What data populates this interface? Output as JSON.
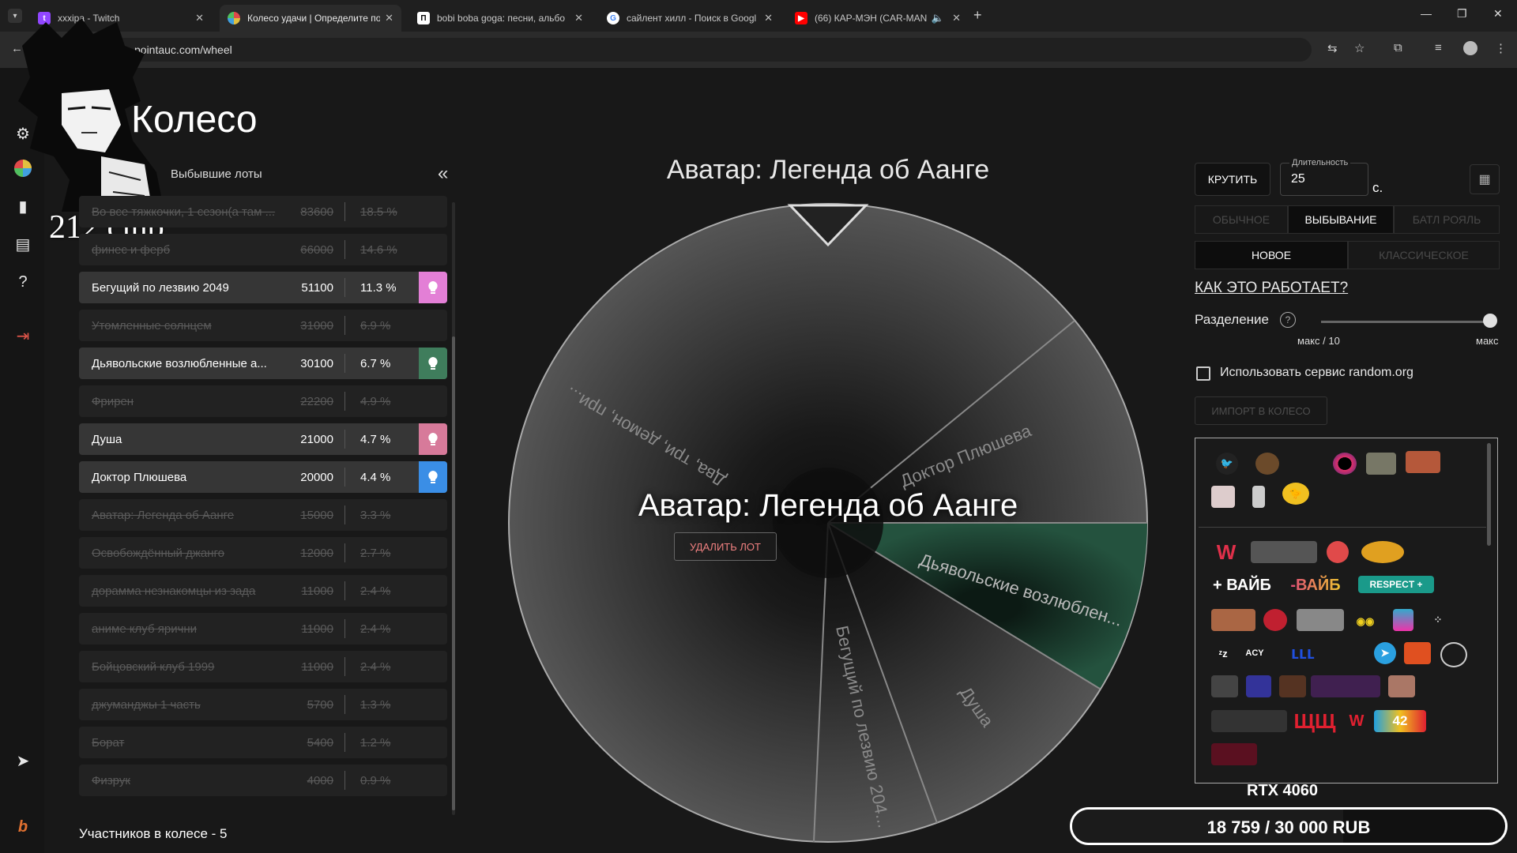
{
  "browser": {
    "tabs": [
      {
        "title": "xxxipa - Twitch",
        "favicon_color": "#9146ff",
        "active": false
      },
      {
        "title": "Колесо удачи | Определите по",
        "favicon_color": "#e0a040",
        "active": true
      },
      {
        "title": "bobi boba goga: песни, альбо",
        "favicon_color": "#444444",
        "active": false
      },
      {
        "title": "сайлент хилл - Поиск в Googl",
        "favicon_color": "#ffffff",
        "active": false
      },
      {
        "title": "(66) КАР-МЭН (CAR-MAN)",
        "favicon_color": "#ff0000",
        "active": false
      }
    ],
    "url": "pointauc.com/wheel"
  },
  "overlay": {
    "club_text": "212 club"
  },
  "page": {
    "title": "Колесо",
    "lots_header": "Выбывшие лоты",
    "participants": "Участников в колесе - 5"
  },
  "lots": [
    {
      "name": "Во все тяжкочки, 1 сезон(а там ...",
      "amount": "83600",
      "percent": "18.5 %",
      "state": "out"
    },
    {
      "name": "финес и ферб",
      "amount": "66000",
      "percent": "14.6 %",
      "state": "out"
    },
    {
      "name": "Бегущий по лезвию 2049",
      "amount": "51100",
      "percent": "11.3 %",
      "state": "alive",
      "color": "#e37fd6"
    },
    {
      "name": "Утомленные солнцем",
      "amount": "31000",
      "percent": "6.9 %",
      "state": "out"
    },
    {
      "name": "Дьявольские возлюбленные а...",
      "amount": "30100",
      "percent": "6.7 %",
      "state": "alive",
      "color": "#3f7d5c"
    },
    {
      "name": "Фрирен",
      "amount": "22200",
      "percent": "4.9 %",
      "state": "out"
    },
    {
      "name": "Душа",
      "amount": "21000",
      "percent": "4.7 %",
      "state": "alive",
      "color": "#d77a9a"
    },
    {
      "name": "Доктор Плюшева",
      "amount": "20000",
      "percent": "4.4 %",
      "state": "alive",
      "color": "#3a8ee6"
    },
    {
      "name": "Аватар: Легенда об Аанге",
      "amount": "15000",
      "percent": "3.3 %",
      "state": "out"
    },
    {
      "name": "Освобождённый джанго",
      "amount": "12000",
      "percent": "2.7 %",
      "state": "out"
    },
    {
      "name": "дорамма незнакомцы из зада",
      "amount": "11000",
      "percent": "2.4 %",
      "state": "out"
    },
    {
      "name": "аниме клуб ярични",
      "amount": "11000",
      "percent": "2.4 %",
      "state": "out"
    },
    {
      "name": "Бойцовский клуб 1999",
      "amount": "11000",
      "percent": "2.4 %",
      "state": "out"
    },
    {
      "name": "джуманджы 1 часть",
      "amount": "5700",
      "percent": "1.3 %",
      "state": "out"
    },
    {
      "name": "Борат",
      "amount": "5400",
      "percent": "1.2 %",
      "state": "out"
    },
    {
      "name": "Физрук",
      "amount": "4000",
      "percent": "0.9 %",
      "state": "out"
    }
  ],
  "wheel": {
    "winner_title": "Аватар: Легенда об Аанге",
    "center_name": "Аватар: Легенда об Аанге",
    "delete_label": "УДАЛИТЬ ЛОТ",
    "segment_labels": [
      "Два, три, демон, при...",
      "Доктор Плюшева",
      "Дьявольские возлюблен...",
      "Душа",
      "Бегущий по лезвию 204..."
    ]
  },
  "controls": {
    "spin_label": "КРУТИТЬ",
    "duration_label": "Длительность",
    "duration_value": "25",
    "duration_unit": "с.",
    "modes": [
      "ОБЫЧНОЕ",
      "ВЫБЫВАНИЕ",
      "БАТЛ РОЯЛЬ"
    ],
    "active_mode": "ВЫБЫВАНИЕ",
    "variants": [
      "НОВОЕ",
      "КЛАССИЧЕСКОЕ"
    ],
    "active_variant": "НОВОЕ",
    "how_link": "КАК ЭТО РАБОТАЕТ?",
    "split_label": "Разделение",
    "split_value": 1.0,
    "slider_min": "макс / 10",
    "slider_max": "макс",
    "random_org_label": "Использовать сервис random.org",
    "random_org_checked": false,
    "import_label": "ИМПОРТ В КОЛЕСО"
  },
  "emotes": [
    "+ ВАЙБ",
    "-ВАЙБ",
    "RESPECT +",
    "ЩЩ",
    "W",
    "42",
    "ACY"
  ],
  "donation_goal": {
    "title": "RTX 4060",
    "current": 18759,
    "target": 30000,
    "text": "18 759 / 30 000 RUB"
  },
  "colors": {
    "accent_pink": "#e37fd6",
    "accent_green": "#3f7d5c",
    "accent_rose": "#d77a9a",
    "accent_blue": "#3a8ee6",
    "wheel_green": "#1f4a38"
  }
}
